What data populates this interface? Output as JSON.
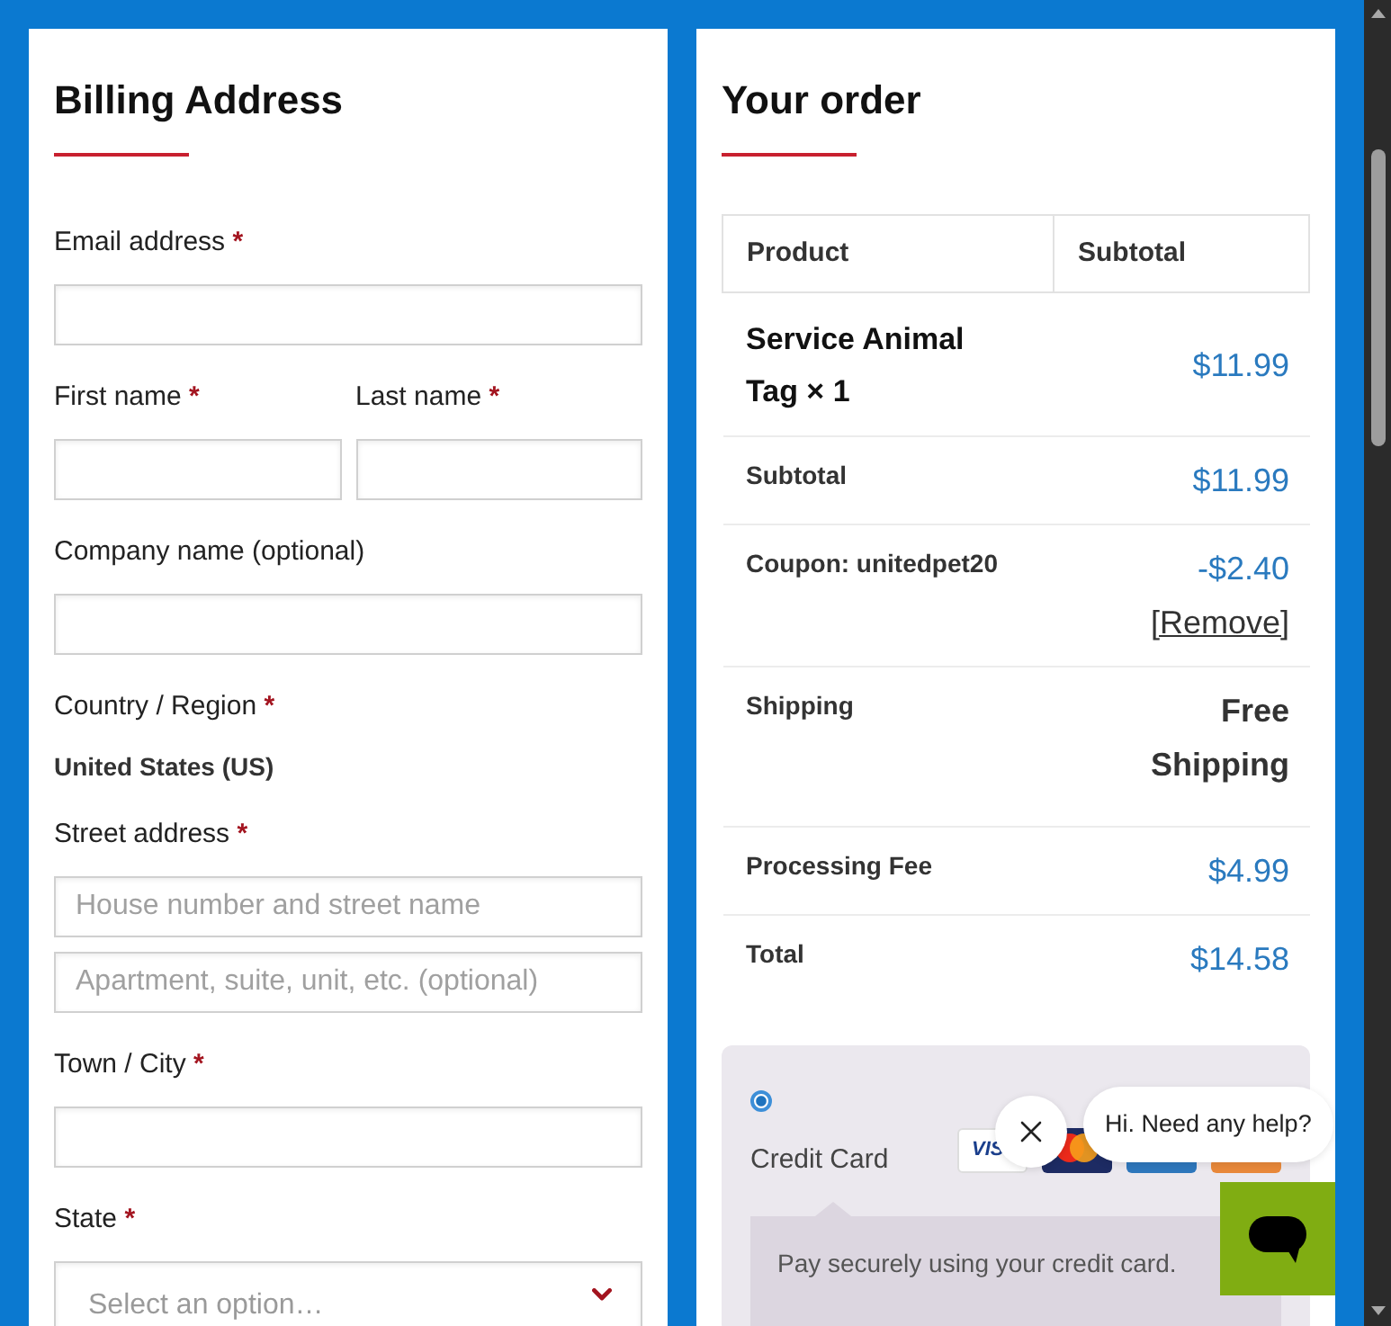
{
  "billing": {
    "title": "Billing Address",
    "fields": [
      {
        "kind": "input",
        "label": "Email address",
        "asterisk": "*"
      },
      {
        "kind": "pair",
        "fields": [
          {
            "label": "First name",
            "asterisk": "*"
          },
          {
            "label": "Last name",
            "asterisk": "*"
          }
        ]
      },
      {
        "kind": "input",
        "label": "Company name (optional)"
      },
      {
        "kind": "static",
        "label": "Country / Region",
        "asterisk": "*",
        "value": "United States (US)"
      },
      {
        "kind": "inputs",
        "label": "Street address",
        "asterisk": "*",
        "placeholders": [
          "House number and street name",
          "Apartment, suite, unit, etc. (optional)"
        ]
      },
      {
        "kind": "input",
        "label": "Town / City",
        "asterisk": "*"
      },
      {
        "kind": "select",
        "label": "State",
        "asterisk": "*",
        "placeholder": "Select an option…"
      }
    ]
  },
  "order": {
    "title": "Your order",
    "columns": [
      "Product",
      "Subtotal"
    ],
    "rows": [
      {
        "kind": "item",
        "label": "Service Animal Tag × 1",
        "amount": "$11.99"
      },
      {
        "kind": "subtotal",
        "label": "Subtotal",
        "amount": "$11.99"
      },
      {
        "kind": "coupon",
        "label": "Coupon: unitedpet20",
        "amount": "-$2.40",
        "link": "[Remove]"
      },
      {
        "kind": "shipping",
        "label": "Shipping",
        "value": "Free Shipping"
      },
      {
        "kind": "fee",
        "label": "Processing Fee",
        "amount": "$4.99"
      },
      {
        "kind": "total",
        "label": "Total",
        "amount": "$14.58"
      }
    ]
  },
  "payment": {
    "methods": [
      {
        "label": "Credit Card",
        "selected": true,
        "logos": [
          {
            "kind": "visa",
            "text": "VIS"
          },
          {
            "kind": "mastercard"
          },
          {
            "kind": "amex"
          },
          {
            "kind": "discover"
          }
        ],
        "description": "Pay securely using your credit card."
      }
    ]
  },
  "chat": {
    "message": "Hi. Need any help?"
  }
}
